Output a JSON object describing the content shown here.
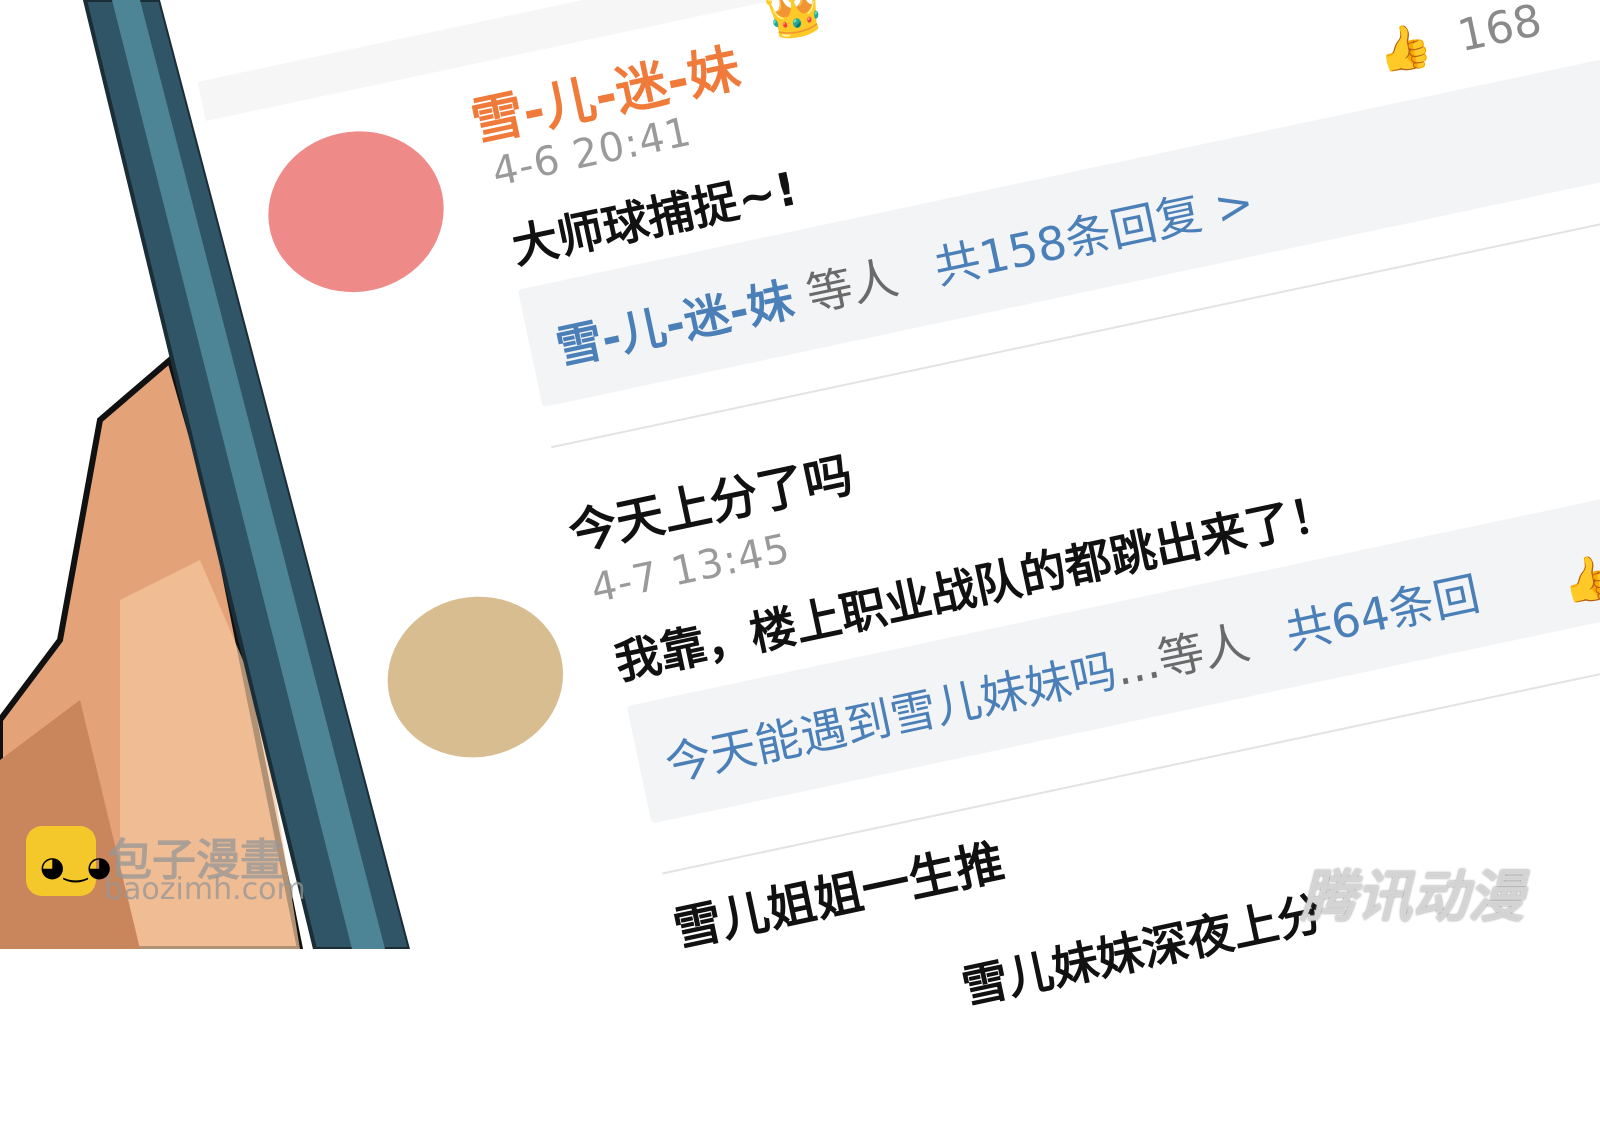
{
  "comments": [
    {
      "username": "雪-儿-迷-妹",
      "time": "4-6 20:41",
      "content": "大师球捕捉~!",
      "reply_preview": {
        "name": "雪-儿-迷-妹",
        "suffix": " 等人",
        "count": "共158条回复 >"
      },
      "likes": "168",
      "avatar_color": "#ee8a88"
    },
    {
      "username": "今天上分了吗",
      "time": "4-7 13:45",
      "content": "我靠，楼上职业战队的都跳出来了！",
      "reply_preview": {
        "name": "今天能遇到雪儿妹妹吗",
        "suffix": "...等人",
        "count": "共64条回"
      },
      "avatar_color": "#d8bd91"
    },
    {
      "username": "雪儿姐姐一生推",
      "content": "雪儿妹妹深夜上分"
    }
  ],
  "watermark": {
    "name": "包子漫畫",
    "url": "baozimh.com",
    "right": "腾讯动漫"
  },
  "colors": {
    "username_accent": "#f07a3a",
    "link_blue": "#4a7fb8",
    "phone_frame": "#2f5566",
    "skin": "#e3a278"
  }
}
